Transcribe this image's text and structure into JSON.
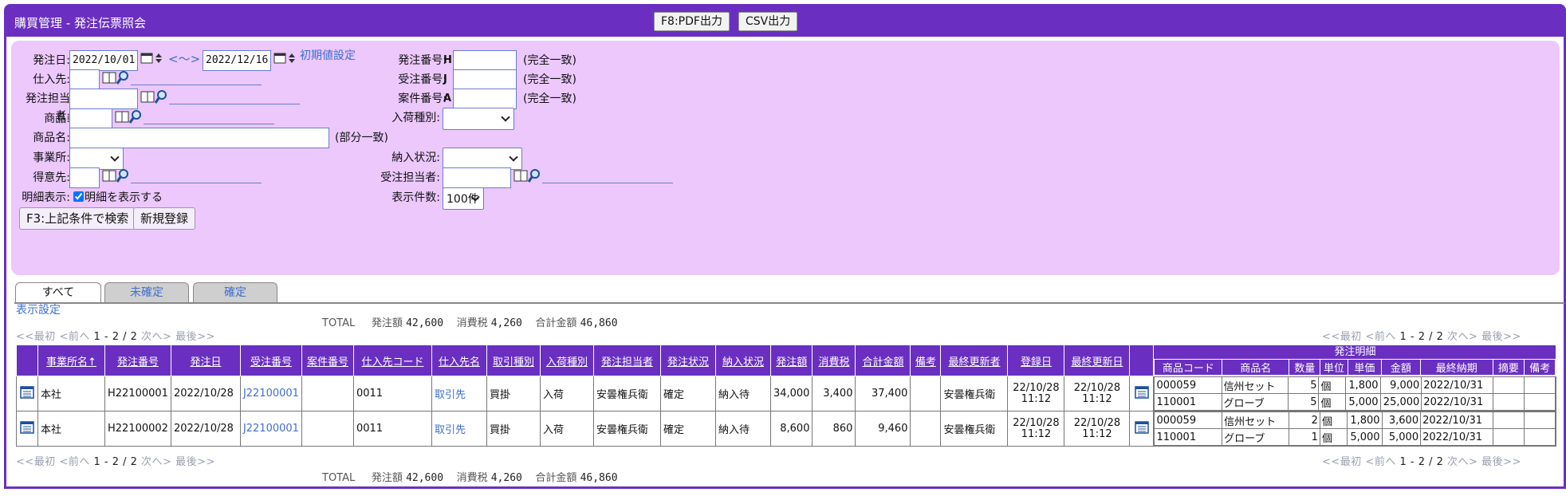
{
  "window": {
    "title": "購買管理 - 発注伝票照会",
    "pdf_button": "F8:PDF出力",
    "csv_button": "CSV出力"
  },
  "form": {
    "order_date_label": "発注日:",
    "date_from": "2022/10/01",
    "range_sep": "<～>",
    "date_to": "2022/12/16",
    "reset_link": "初期値設定",
    "supplier_label": "仕入先:",
    "staff_label": "発注担当者:",
    "product_label": "商品:",
    "product_name_label": "商品名:",
    "partial_match": "(部分一致)",
    "office_label": "事業所:",
    "customer_label": "得意先:",
    "detail_label": "明細表示:",
    "detail_checkbox": "明細を表示する",
    "order_no_label": "発注番号:",
    "order_no_prefix": "H",
    "recv_no_label": "受注番号:",
    "recv_no_prefix": "J",
    "case_no_label": "案件番号:",
    "case_no_prefix": "A",
    "exact_match": "(完全一致)",
    "arrival_type_label": "入荷種別:",
    "delivery_status_label": "納入状況:",
    "recv_staff_label": "受注担当者:",
    "display_count_label": "表示件数:",
    "display_count_value": "100件",
    "search_button": "F3:上記条件で検索",
    "new_button": "新規登録"
  },
  "tabs": [
    "すべて",
    "未確定",
    "確定"
  ],
  "display_settings": "表示設定",
  "pager": {
    "first": "<<最初",
    "prev": "<前へ",
    "range": "1 - 2 / 2",
    "next": "次へ>",
    "last": "最後>>"
  },
  "totals": {
    "label": "TOTAL",
    "order_amount_label": "発注額",
    "order_amount": "42,600",
    "tax_label": "消費税",
    "tax": "4,260",
    "total_label": "合計金額",
    "total": "46,860"
  },
  "table": {
    "columns": [
      "事業所名↑",
      "発注番号",
      "発注日",
      "受注番号",
      "案件番号",
      "仕入先コード",
      "仕入先名",
      "取引種別",
      "入荷種別",
      "発注担当者",
      "発注状況",
      "納入状況",
      "発注額",
      "消費税",
      "合計金額",
      "備考",
      "最終更新者",
      "登録日",
      "最終更新日"
    ],
    "detail_header": "発注明細",
    "detail_columns": [
      "商品コード",
      "商品名",
      "数量",
      "単位",
      "単価",
      "金額",
      "最終納期",
      "摘要",
      "備考"
    ],
    "rows": [
      {
        "office": "本社",
        "order_no": "H22100001",
        "order_date": "2022/10/28",
        "recv_no": "J22100001",
        "case_no": "",
        "supplier_code": "0011",
        "supplier_name": "取引先",
        "trade_type": "買掛",
        "arrival_type": "入荷",
        "staff": "安曇権兵衛",
        "order_status": "確定",
        "delivery_status": "納入待",
        "amount": "34,000",
        "tax": "3,400",
        "total": "37,400",
        "note": "",
        "updater": "安曇権兵衛",
        "reg_date": "22/10/28",
        "reg_time": "11:12",
        "upd_date": "22/10/28",
        "upd_time": "11:12",
        "details": [
          {
            "code": "000059",
            "name": "信州セット",
            "qty": "5",
            "unit": "個",
            "price": "1,800",
            "amount": "9,000",
            "due": "2022/10/31",
            "summary": "",
            "note": ""
          },
          {
            "code": "110001",
            "name": "グローブ",
            "qty": "5",
            "unit": "個",
            "price": "5,000",
            "amount": "25,000",
            "due": "2022/10/31",
            "summary": "",
            "note": ""
          }
        ]
      },
      {
        "office": "本社",
        "order_no": "H22100002",
        "order_date": "2022/10/28",
        "recv_no": "J22100001",
        "case_no": "",
        "supplier_code": "0011",
        "supplier_name": "取引先",
        "trade_type": "買掛",
        "arrival_type": "入荷",
        "staff": "安曇権兵衛",
        "order_status": "確定",
        "delivery_status": "納入待",
        "amount": "8,600",
        "tax": "860",
        "total": "9,460",
        "note": "",
        "updater": "安曇権兵衛",
        "reg_date": "22/10/28",
        "reg_time": "11:12",
        "upd_date": "22/10/28",
        "upd_time": "11:12",
        "details": [
          {
            "code": "000059",
            "name": "信州セット",
            "qty": "2",
            "unit": "個",
            "price": "1,800",
            "amount": "3,600",
            "due": "2022/10/31",
            "summary": "",
            "note": ""
          },
          {
            "code": "110001",
            "name": "グローブ",
            "qty": "1",
            "unit": "個",
            "price": "5,000",
            "amount": "5,000",
            "due": "2022/10/31",
            "summary": "",
            "note": ""
          }
        ]
      }
    ]
  }
}
